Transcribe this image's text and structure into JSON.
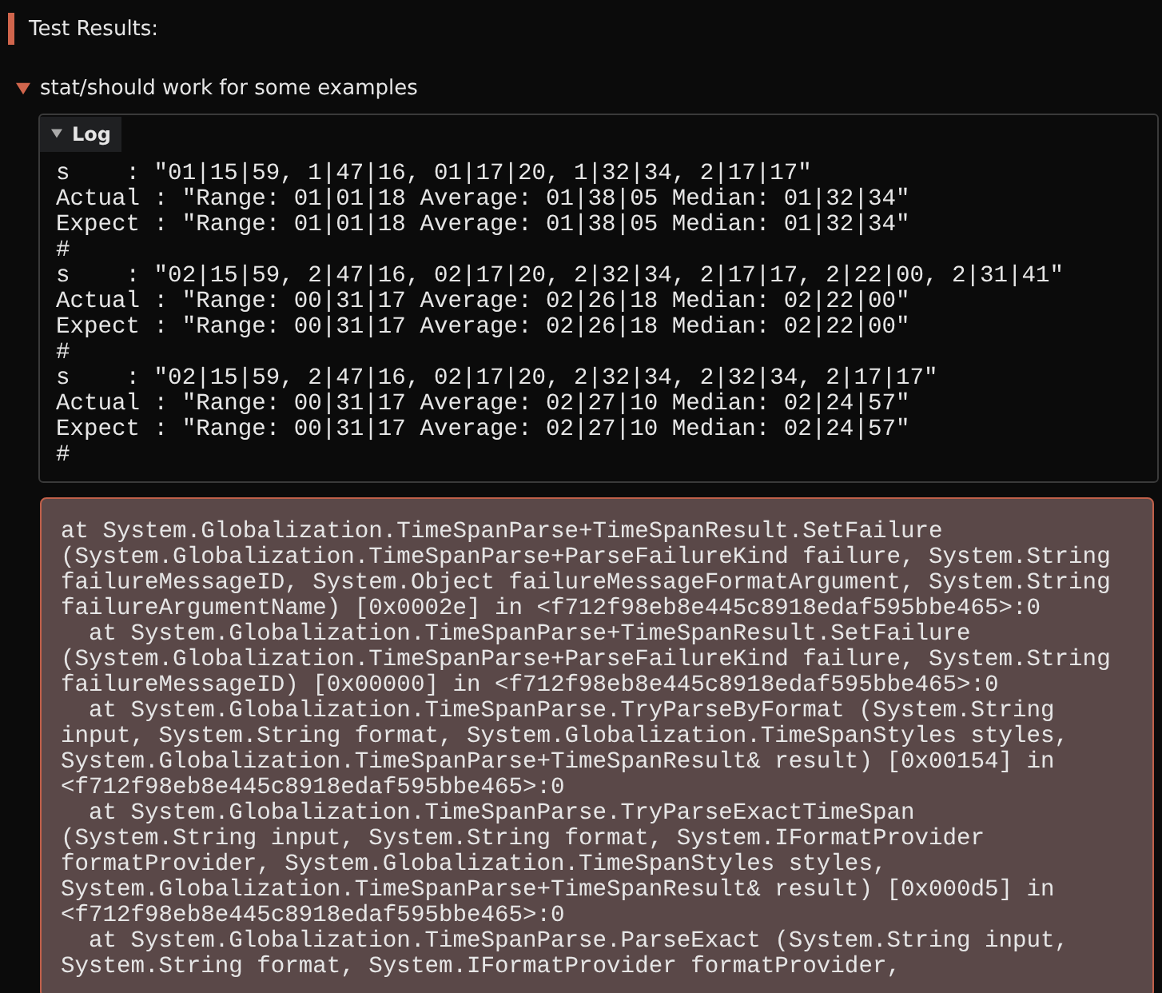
{
  "section": {
    "title": "Test Results:"
  },
  "test": {
    "title": "stat/should work for some examples",
    "expanded": true,
    "log": {
      "label": "Log",
      "expanded": true,
      "lines": [
        "s    : \"01|15|59, 1|47|16, 01|17|20, 1|32|34, 2|17|17\"",
        "Actual : \"Range: 01|01|18 Average: 01|38|05 Median: 01|32|34\"",
        "Expect : \"Range: 01|01|18 Average: 01|38|05 Median: 01|32|34\"",
        "#",
        "s    : \"02|15|59, 2|47|16, 02|17|20, 2|32|34, 2|17|17, 2|22|00, 2|31|41\"",
        "Actual : \"Range: 00|31|17 Average: 02|26|18 Median: 02|22|00\"",
        "Expect : \"Range: 00|31|17 Average: 02|26|18 Median: 02|22|00\"",
        "#",
        "s    : \"02|15|59, 2|47|16, 02|17|20, 2|32|34, 2|32|34, 2|17|17\"",
        "Actual : \"Range: 00|31|17 Average: 02|27|10 Median: 02|24|57\"",
        "Expect : \"Range: 00|31|17 Average: 02|27|10 Median: 02|24|57\"",
        "#"
      ]
    },
    "error": {
      "lines": [
        "at System.Globalization.TimeSpanParse+TimeSpanResult.SetFailure",
        "(System.Globalization.TimeSpanParse+ParseFailureKind failure, System.String",
        "failureMessageID, System.Object failureMessageFormatArgument, System.String",
        "failureArgumentName) [0x0002e] in <f712f98eb8e445c8918edaf595bbe465>:0",
        "  at System.Globalization.TimeSpanParse+TimeSpanResult.SetFailure",
        "(System.Globalization.TimeSpanParse+ParseFailureKind failure, System.String",
        "failureMessageID) [0x00000] in <f712f98eb8e445c8918edaf595bbe465>:0",
        "  at System.Globalization.TimeSpanParse.TryParseByFormat (System.String",
        "input, System.String format, System.Globalization.TimeSpanStyles styles,",
        "System.Globalization.TimeSpanParse+TimeSpanResult& result) [0x00154] in",
        "<f712f98eb8e445c8918edaf595bbe465>:0",
        "  at System.Globalization.TimeSpanParse.TryParseExactTimeSpan",
        "(System.String input, System.String format, System.IFormatProvider",
        "formatProvider, System.Globalization.TimeSpanStyles styles,",
        "System.Globalization.TimeSpanParse+TimeSpanResult& result) [0x000d5] in",
        "<f712f98eb8e445c8918edaf595bbe465>:0",
        "  at System.Globalization.TimeSpanParse.ParseExact (System.String input,",
        "System.String format, System.IFormatProvider formatProvider,"
      ]
    }
  }
}
